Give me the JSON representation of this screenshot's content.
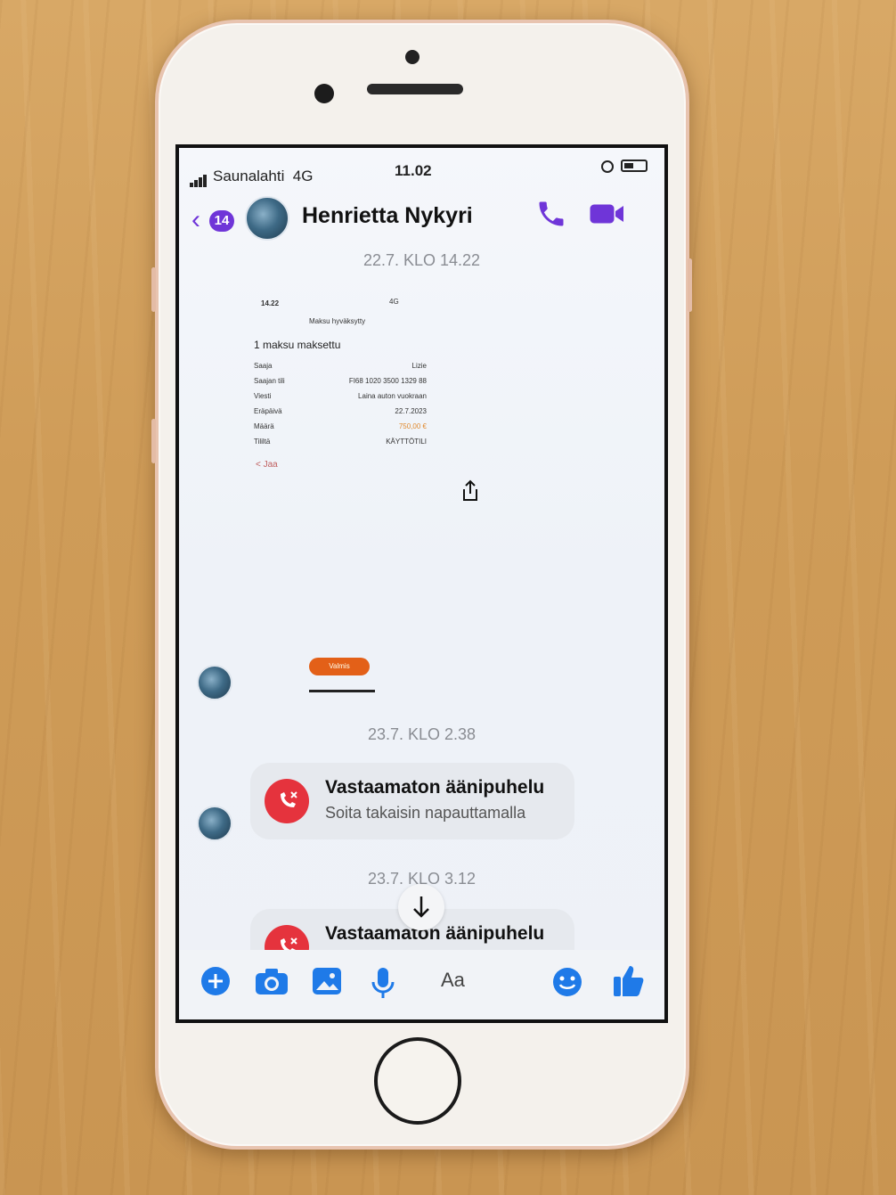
{
  "status_bar": {
    "carrier": "Saunalahti",
    "network": "4G",
    "time": "11.02"
  },
  "header": {
    "unread_count": "14",
    "contact_name": "Henrietta Nykyri",
    "back_icon": "chevron-left-icon",
    "call_icon": "phone-icon",
    "video_icon": "video-camera-icon",
    "accent_color": "#6f35d8"
  },
  "messages": {
    "timestamp_1": "22.7. KLO 14.22",
    "timestamp_2": "23.7. KLO 2.38",
    "timestamp_3": "23.7. KLO 3.12"
  },
  "receipt": {
    "time": "14.22",
    "signal": "4G",
    "title": "Maksu hyväksytty",
    "heading": "1 maksu maksettu",
    "rows": [
      {
        "label": "Saaja",
        "value": "Lizie"
      },
      {
        "label": "Saajan tili",
        "value": "FI68 1020 3500 1329 88"
      },
      {
        "label": "Viesti",
        "value": "Laina auton vuokraan"
      },
      {
        "label": "Eräpäivä",
        "value": "22.7.2023"
      },
      {
        "label": "Määrä",
        "value": "750,00 €"
      },
      {
        "label": "Tililtä",
        "value": "KÄYTTÖTILI"
      }
    ],
    "share_label": "Jaa",
    "button_label": "Valmis",
    "amount_color": "#e08a2e"
  },
  "missed_calls": [
    {
      "title": "Vastaamaton äänipuhelu",
      "subtitle": "Soita takaisin napauttamalla"
    },
    {
      "title": "Vastaamaton äänipuhelu",
      "subtitle": ""
    }
  ],
  "composer": {
    "placeholder": "Aa",
    "icons": [
      "plus-icon",
      "camera-icon",
      "image-icon",
      "microphone-icon",
      "emoji-icon",
      "thumbs-up-icon"
    ]
  }
}
